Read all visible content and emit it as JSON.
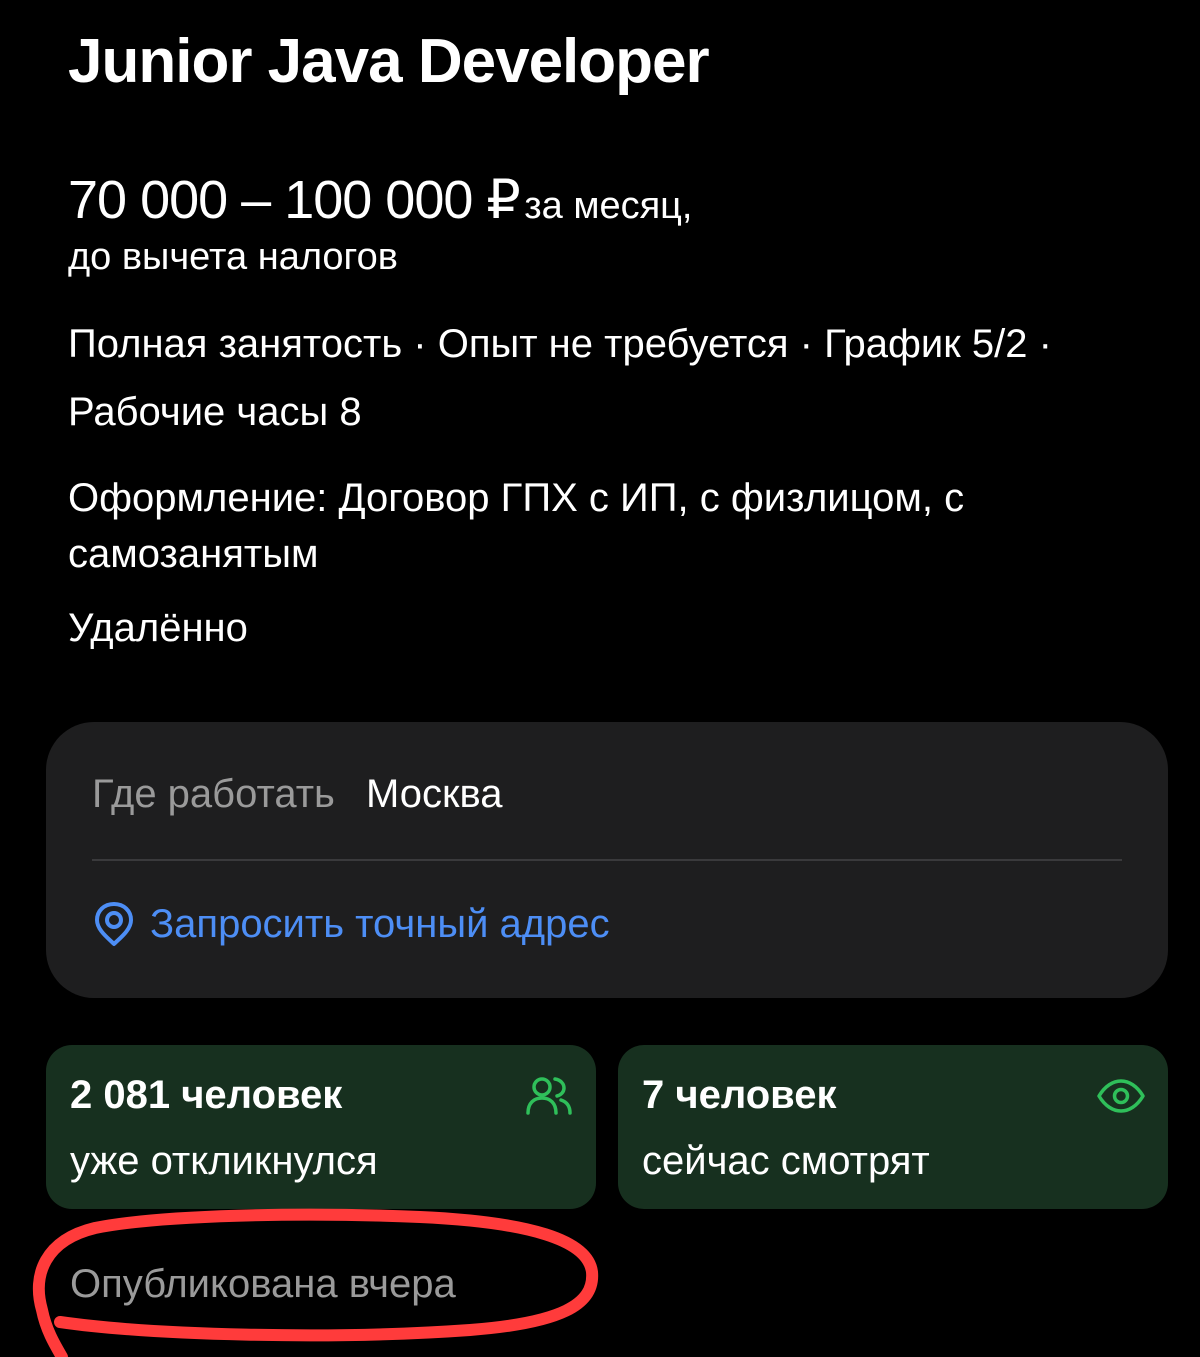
{
  "vacancy": {
    "title": "Junior Java Developer",
    "salary_amount": "70 000 – 100 000 ₽",
    "salary_period": "за месяц,",
    "salary_note": "до вычета налогов",
    "attributes": "Полная занятость · Опыт не требуется · График 5/2 · Рабочие часы 8",
    "contract": "Оформление: Договор ГПХ с ИП, с физлицом, с самозанятым",
    "work_format": "Удалённо"
  },
  "location": {
    "label": "Где работать",
    "city": "Москва",
    "request_address_label": "Запросить точный адрес",
    "icon": "location-pin-icon"
  },
  "stats": {
    "responses": {
      "count": "2 081 человек",
      "caption": "уже откликнулся",
      "icon": "people-icon"
    },
    "viewers": {
      "count": "7 человек",
      "caption": "сейчас смотрят",
      "icon": "eye-icon"
    }
  },
  "published": "Опубликована вчера",
  "colors": {
    "background": "#000000",
    "card": "#1e1e1f",
    "stat_card": "#17301f",
    "link": "#4d8ef5",
    "accent_green": "#2fbf5a",
    "annotation_red": "#ff3b3b"
  }
}
